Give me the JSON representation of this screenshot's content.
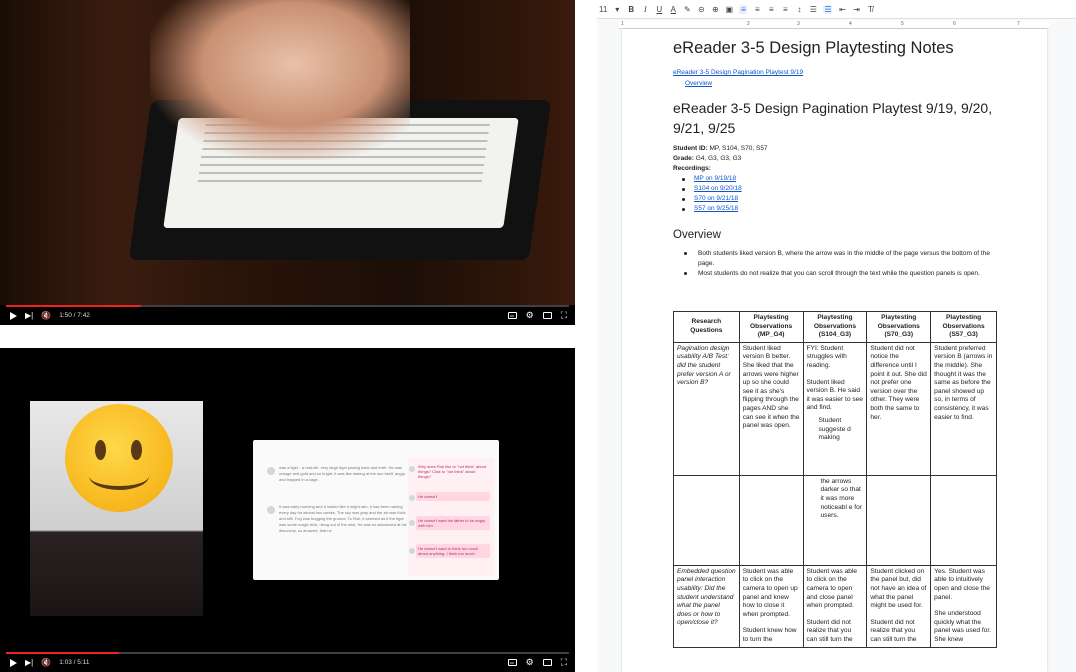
{
  "video1": {
    "time": "1:50 / 7:42",
    "progress": 0.24
  },
  "video2": {
    "time": "1:03 / 5:11",
    "progress": 0.2,
    "reader_text_1": "was a tiger - a real-life, very large tiger pacing back and forth. He was orange and gold and so bright, it was like staring at the sun itself, angry and trapped in a cage.",
    "reader_text_2": "It was early morning and it looked like it might rain; it had been raining every day for almost two weeks. The sky was gray and the air was thick and still. Fog was hugging the ground. To Rob, it seemed as if the tiger was some magic trick, rising out of the mist. He was so astounded at his discovery, so amazed, that he",
    "q1": "Why does Rob like to \"not think\" about things? Click to \"not think\" about things?",
    "q2": "He doesn't",
    "q3": "He doesn't want his father to be angry with him.",
    "q4": "He doesn't want to think too much about anything. I think too much"
  },
  "toolbar": {
    "font_size": "11",
    "bold": "B",
    "italic": "I",
    "underline": "U",
    "text_color": "A",
    "items": [
      "✎",
      "⊕",
      "▣",
      "▦"
    ]
  },
  "ruler": [
    "1",
    "2",
    "3",
    "4",
    "5",
    "6",
    "7"
  ],
  "doc": {
    "title": "eReader 3-5 Design Playtesting Notes",
    "toc_link": "eReader 3-5 Design Pagination Playtest 9/19",
    "toc_sub": "Overview",
    "heading": "eReader 3-5 Design Pagination Playtest 9/19, 9/20, 9/21, 9/25",
    "student_id_label": "Student ID:",
    "student_id": "MP, S104, S70, S57",
    "grade_label": "Grade:",
    "grade": "G4, G3, G3, G3",
    "recordings_label": "Recordings:",
    "recordings": [
      "MP on 9/19/18",
      "S104 on 9/20/18",
      "S70 on 9/21/18",
      "S57 on 9/25/18"
    ],
    "overview_heading": "Overview",
    "overview_bullets": [
      "Both students liked version B, where the arrow was in the middle of the page versus the bottom of the page.",
      "Most students do not realize that you can scroll through the text while the question panels is open."
    ],
    "table": {
      "headers": [
        "Research Questions",
        "Playtesting Observations (MP_G4)",
        "Playtesting Observations (S104_G3)",
        "Playtesting Observations (S70_G3)",
        "Playtesting Observations (S57_G3)"
      ],
      "row1": [
        "Pagination design usability A/B Test: did the student prefer version A or version B?",
        "Student liked version B better. She liked that the arrows were higher up so she could see it as she's flipping through the pages AND she can see it when the panel was open.",
        "FYI: Student struggles with reading.",
        "Student did not notice the difference until I point it out. She did not prefer one version over the other. They were both the same to her.",
        "Student preferred version B (arrows in the middle). She thought it was the same as before the panel showed up so, in terms of consistency, it was easier to find."
      ],
      "row1_c2b": "Student liked version B. He said it was easier to see and find.",
      "row1_c2c": "Student suggeste d making",
      "row1_c2d": "the arrows darker so that it was more noticeabl e for users.",
      "row2": [
        "Embedded question panel interaction usability: Did the student understand what the panel does or how to open/close it?",
        "Student was able to click on the camera to open up panel and knew how to close it when prompted.",
        "Student was able to click on the camera to open and close panel when prompted.",
        "Student clicked on the panel but, did not have an idea of what the panel might be used for.",
        "Yes. Student was able to intuitively open and close the panel."
      ],
      "row2_c1b": "Student knew how to turn the",
      "row2_c2b": "Student did not realize that you can still turn the",
      "row2_c3b": "Student did not realize that you can still turn the",
      "row2_c4b": "She understood quickly what the panel was used for. She knew"
    }
  }
}
